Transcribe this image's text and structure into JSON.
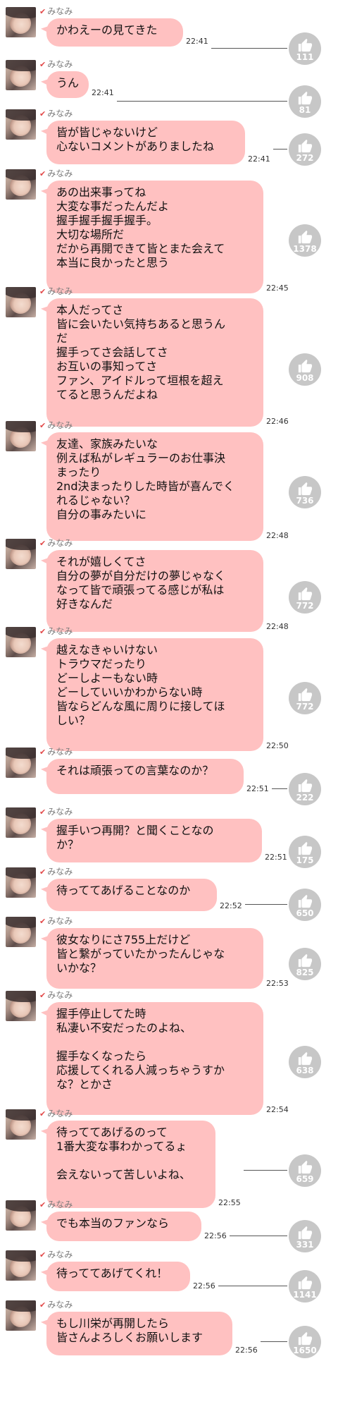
{
  "messages": [
    {
      "name": "みなみ",
      "text": "かわえーの見てきた",
      "time": "22:41",
      "likes": "111"
    },
    {
      "name": "みなみ",
      "text": "うん",
      "time": "22:41",
      "likes": "81"
    },
    {
      "name": "みなみ",
      "text": "皆が皆じゃないけど\n心ないコメントがありましたね",
      "time": "22:41",
      "likes": "272"
    },
    {
      "name": "みなみ",
      "text": "あの出来事ってね\n大変な事だったんだよ\n握手握手握手握手。\n大切な場所だ\nだから再開できて皆とまた会えて\n本当に良かったと思う",
      "time": "22:45",
      "likes": "1378"
    },
    {
      "name": "みなみ",
      "text": "本人だってさ\n皆に会いたい気持ちあると思うん\nだ\n握手ってさ会話してさ\nお互いの事知ってさ\nファン、アイドルって垣根を超え\nてると思うんだよね",
      "time": "22:46",
      "likes": "908"
    },
    {
      "name": "みなみ",
      "text": "友達、家族みたいな\n例えば私がレギュラーのお仕事決\nまったり\n2nd決まったりした時皆が喜んでく\nれるじゃない？\n自分の事みたいに",
      "time": "22:48",
      "likes": "736"
    },
    {
      "name": "みなみ",
      "text": "それが嬉しくてさ\n自分の夢が自分だけの夢じゃなく\nなって皆で頑張ってる感じが私は\n好きなんだ",
      "time": "22:48",
      "likes": "772"
    },
    {
      "name": "みなみ",
      "text": "越えなきゃいけない\nトラウマだったり\nどーしよーもない時\nどーしていいかわからない時\n皆ならどんな風に周りに接してほ\nしい？",
      "time": "22:50",
      "likes": "772"
    },
    {
      "name": "みなみ",
      "text": "それは頑張っての言葉なのか？",
      "time": "22:51",
      "likes": "222"
    },
    {
      "name": "みなみ",
      "text": "握手いつ再開？と聞くことなの\nか？",
      "time": "22:51",
      "likes": "175"
    },
    {
      "name": "みなみ",
      "text": "待っててあげることなのか",
      "time": "22:52",
      "likes": "650"
    },
    {
      "name": "みなみ",
      "text": "彼女なりにさ755上だけど\n皆と繋がっていたかったんじゃな\nいかな？",
      "time": "22:53",
      "likes": "825"
    },
    {
      "name": "みなみ",
      "text": "握手停止してた時\n私凄い不安だったのよね、\n\n握手なくなったら\n応援してくれる人減っちゃうすか\nな？とかさ",
      "time": "22:54",
      "likes": "638"
    },
    {
      "name": "みなみ",
      "text": "待っててあげるのって\n1番大変な事わかってるょ\n\n会えないって苦しいよね、",
      "time": "22:55",
      "likes": "659"
    },
    {
      "name": "みなみ",
      "text": "でも本当のファンなら",
      "time": "22:56",
      "likes": "331"
    },
    {
      "name": "みなみ",
      "text": "待っててあげてくれ！",
      "time": "22:56",
      "likes": "1141"
    },
    {
      "name": "みなみ",
      "text": "もし川栄が再開したら\n皆さんよろしくお願いします",
      "time": "22:56",
      "likes": "1650"
    }
  ],
  "colors": {
    "bubble": "#ffc1c1",
    "like": "#c7c7c7",
    "name": "#7a7a7a"
  },
  "icons": {
    "like": "thumbs-up-icon",
    "verified": "check-icon"
  }
}
